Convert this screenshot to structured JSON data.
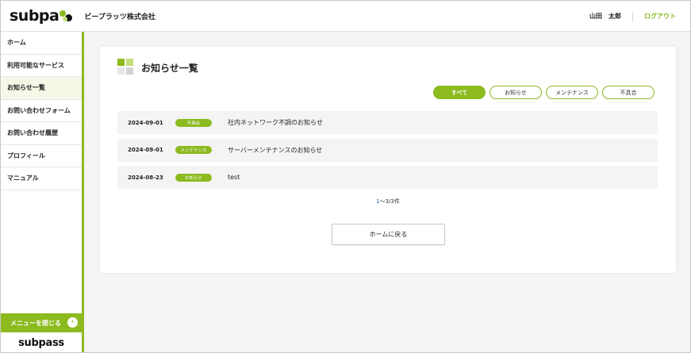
{
  "brand": {
    "logo_text": "subpass",
    "accent": "#8cba1f"
  },
  "header": {
    "company": "ビープラッツ株式会社",
    "username": "山田　太郎",
    "logout": "ログアウト"
  },
  "sidebar": {
    "items": [
      {
        "label": "ホーム"
      },
      {
        "label": "利用可能なサービス"
      },
      {
        "label": "お知らせ一覧"
      },
      {
        "label": "お問い合わせフォーム"
      },
      {
        "label": "お問い合わせ履歴"
      },
      {
        "label": "プロフィール"
      },
      {
        "label": "マニュアル"
      }
    ],
    "active_index": 2,
    "close_menu": "メニューを閉じる",
    "close_icon": "chevron-left-icon"
  },
  "main": {
    "title": "お知らせ一覧",
    "filters": [
      {
        "label": "すべて",
        "active": true
      },
      {
        "label": "お知らせ",
        "active": false
      },
      {
        "label": "メンテナンス",
        "active": false
      },
      {
        "label": "不具合",
        "active": false
      }
    ],
    "notices": [
      {
        "date": "2024-09-01",
        "category": "不具合",
        "title": "社内ネットワーク不調のお知らせ"
      },
      {
        "date": "2024-09-01",
        "category": "メンテナンス",
        "title": "サーバーメンテナンスのお知らせ"
      },
      {
        "date": "2024-08-23",
        "category": "お知らせ",
        "title": "test"
      }
    ],
    "pagination": {
      "start": "1",
      "sep": "～",
      "end": "3",
      "slash": "/",
      "total": "3",
      "unit": "件"
    },
    "home_button": "ホームに戻る"
  }
}
